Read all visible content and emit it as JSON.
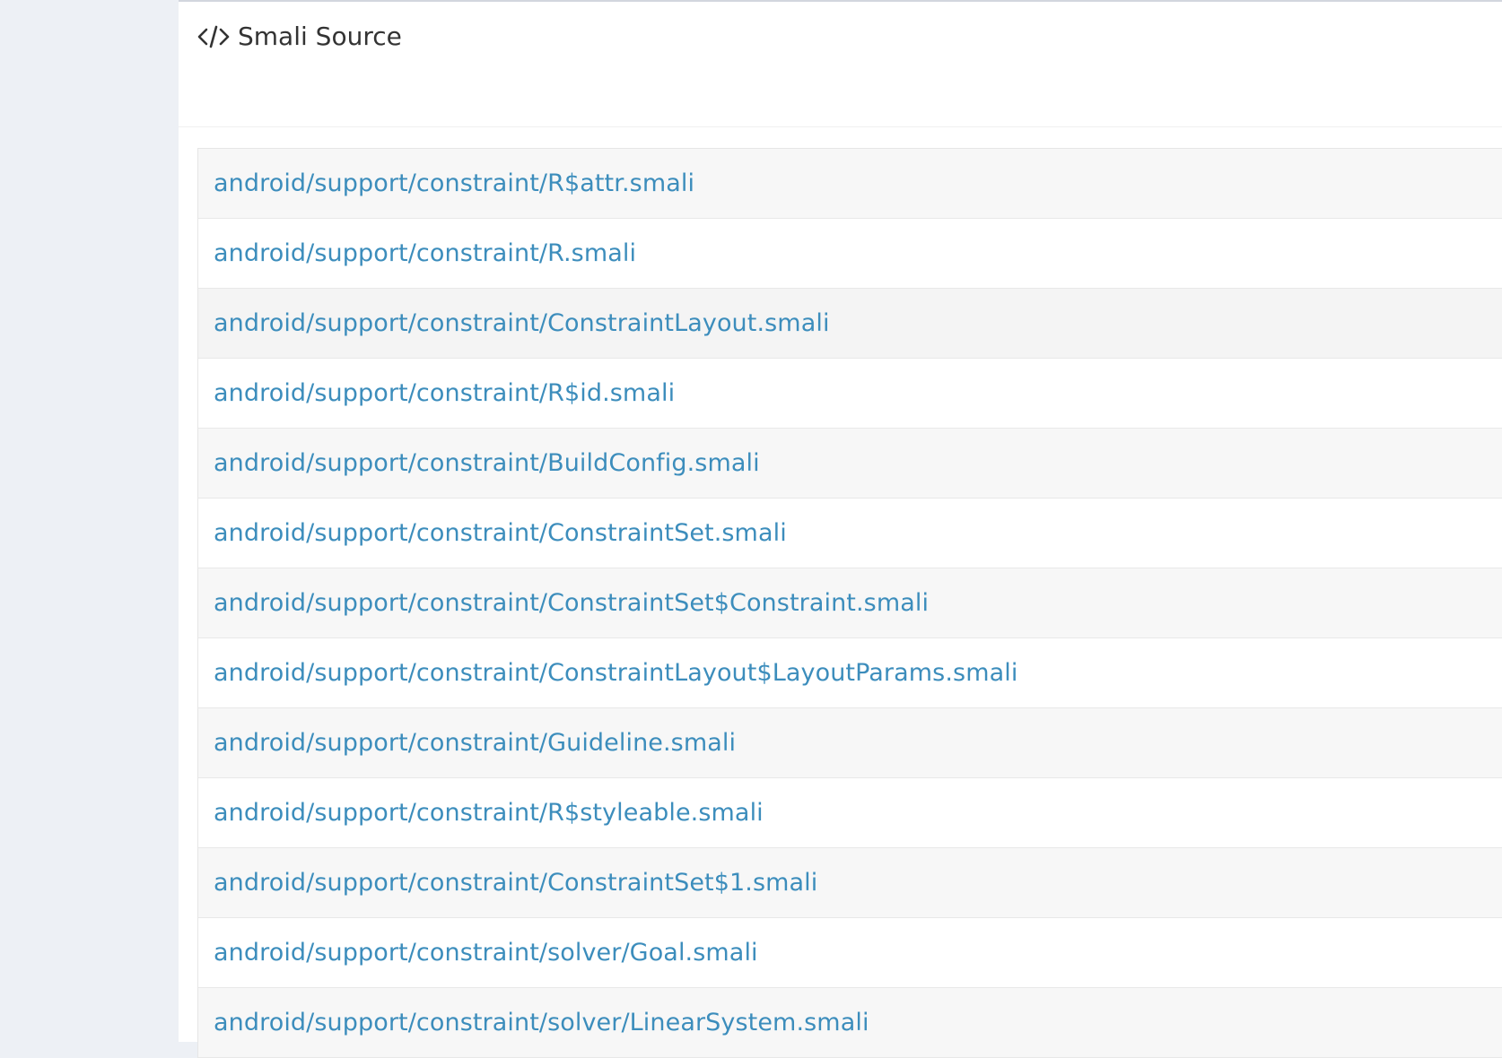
{
  "panel": {
    "title": "Smali Source",
    "icon": "code-icon"
  },
  "colors": {
    "link": "#3c8dbc",
    "page_bg": "#edf0f5",
    "title": "#333333"
  },
  "files": [
    "android/support/constraint/R$attr.smali",
    "android/support/constraint/R.smali",
    "android/support/constraint/ConstraintLayout.smali",
    "android/support/constraint/R$id.smali",
    "android/support/constraint/BuildConfig.smali",
    "android/support/constraint/ConstraintSet.smali",
    "android/support/constraint/ConstraintSet$Constraint.smali",
    "android/support/constraint/ConstraintLayout$LayoutParams.smali",
    "android/support/constraint/Guideline.smali",
    "android/support/constraint/R$styleable.smali",
    "android/support/constraint/ConstraintSet$1.smali",
    "android/support/constraint/solver/Goal.smali",
    "android/support/constraint/solver/LinearSystem.smali"
  ]
}
